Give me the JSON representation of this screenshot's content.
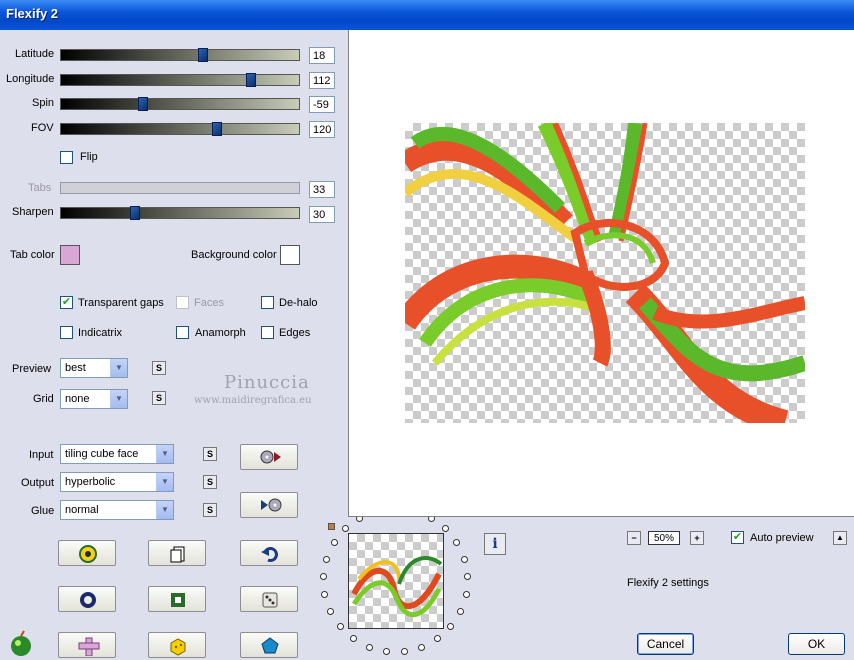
{
  "window": {
    "title": "Flexify 2"
  },
  "sliders": [
    {
      "label": "Latitude",
      "value": "18",
      "position": 0.59
    },
    {
      "label": "Longitude",
      "value": "112",
      "position": 0.8
    },
    {
      "label": "Spin",
      "value": "-59",
      "position": 0.34
    },
    {
      "label": "FOV",
      "value": "120",
      "position": 0.67
    }
  ],
  "flip": {
    "label": "Flip",
    "checked": false
  },
  "tabs": {
    "label": "Tabs",
    "value": "33"
  },
  "sharpen": {
    "label": "Sharpen",
    "value": "30",
    "position": 0.31
  },
  "colors": {
    "tab_color_label": "Tab color",
    "tab_color": "#d9a7d5",
    "background_color_label": "Background color",
    "background_color": "#ffffff"
  },
  "options": {
    "transparent_gaps": {
      "label": "Transparent gaps",
      "checked": true
    },
    "faces": {
      "label": "Faces",
      "checked": false
    },
    "de_halo": {
      "label": "De-halo",
      "checked": false
    },
    "indicatrix": {
      "label": "Indicatrix",
      "checked": false
    },
    "anamorph": {
      "label": "Anamorph",
      "checked": false
    },
    "edges": {
      "label": "Edges",
      "checked": false
    }
  },
  "selects": {
    "preview": {
      "label": "Preview",
      "value": "best"
    },
    "grid": {
      "label": "Grid",
      "value": "none"
    },
    "input": {
      "label": "Input",
      "value": "tiling cube face"
    },
    "output": {
      "label": "Output",
      "value": "hyperbolic"
    },
    "glue": {
      "label": "Glue",
      "value": "normal"
    }
  },
  "small_button_label": "S",
  "watermark": {
    "name": "Pinuccia",
    "site": "www.maidiregrafica.eu"
  },
  "zoom": {
    "level": "50%",
    "minus": "−",
    "plus": "+"
  },
  "auto_preview": {
    "label": "Auto preview",
    "checked": true
  },
  "up_arrow": "▲",
  "info_label": "i",
  "status_text": "Flexify 2 settings",
  "buttons": {
    "cancel": "Cancel",
    "ok": "OK"
  }
}
